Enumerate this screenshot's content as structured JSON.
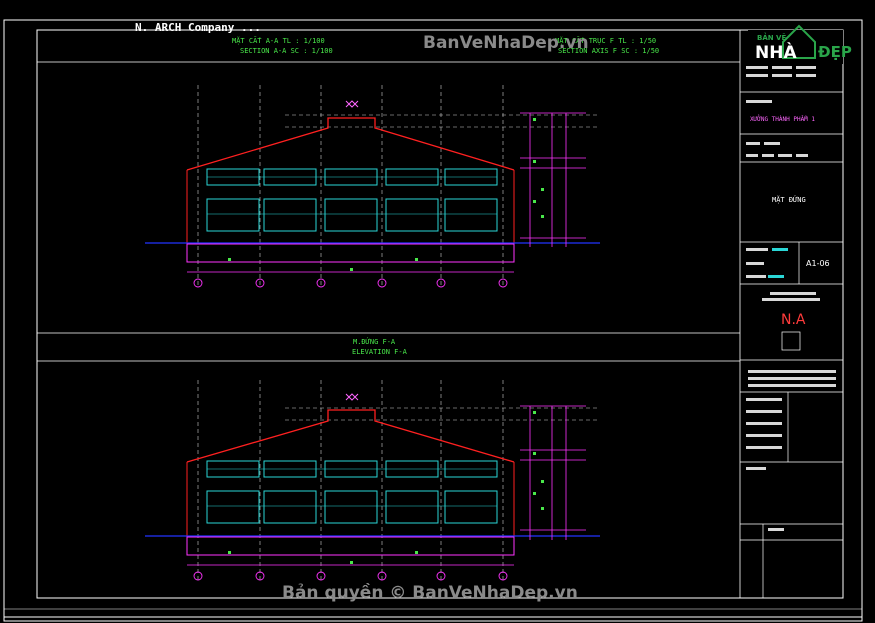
{
  "company": "N. ARCH Company ...",
  "watermark_top": "BanVeNhaDep.vn",
  "watermark_bottom": "Bản quyền © BanVeNhaDep.vn",
  "logo": {
    "line1": "BẢN VẼ",
    "line2": "NHÀ",
    "line3": "ĐẸP"
  },
  "section_left": {
    "line1": "MẶT CẮT A-A      TL : 1/100",
    "line2": "SECTION A-A    SC : 1/100"
  },
  "section_right": {
    "line1": "MẶT CẮT TRỤC F    TL : 1/50",
    "line2": "SECTION AXIS F     SC : 1/50"
  },
  "elevation": {
    "line1": "M.ĐỨNG  F-A",
    "line2": "ELEVATION F-A"
  },
  "title_block": {
    "project": "XƯỞNG THÀNH PHẨM 1",
    "sheet_label": "MẶT ĐỨNG",
    "sheet_code": "A1-06",
    "designer_mark": "N.A"
  },
  "colors": {
    "frame": "#ffffff",
    "roof": "#ff2020",
    "structure": "#ff33ff",
    "facade": "#2ad6d6",
    "annotation": "#49e84a",
    "grid": "#e0e0e0",
    "ground": "#2233ff"
  }
}
